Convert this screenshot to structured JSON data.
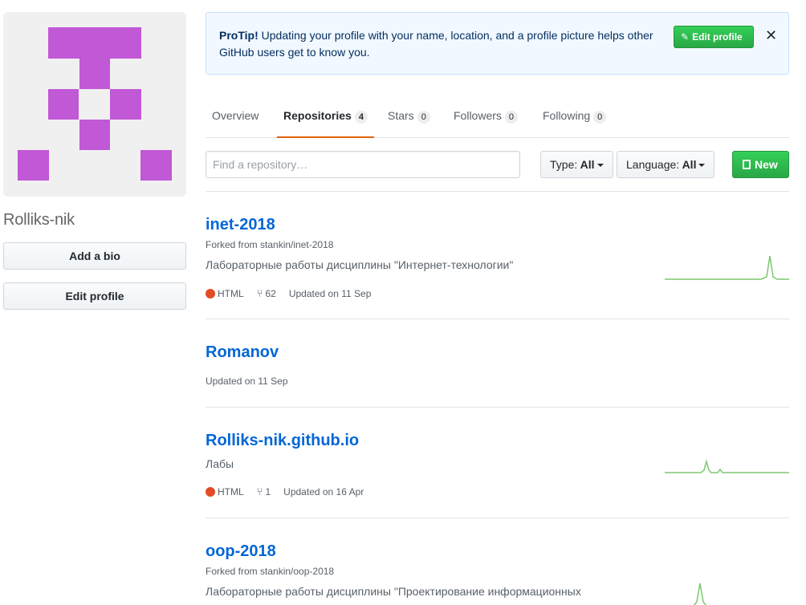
{
  "profile": {
    "username": "Rolliks-nik",
    "add_bio_label": "Add a bio",
    "edit_profile_label": "Edit profile",
    "avatar_color": "#c158d6"
  },
  "protip": {
    "bold": "ProTip!",
    "text": " Updating your profile with your name, location, and a profile picture helps other GitHub users get to know you.",
    "button": "Edit profile",
    "close": "✕"
  },
  "tabs": [
    {
      "label": "Overview",
      "count": ""
    },
    {
      "label": "Repositories",
      "count": "4"
    },
    {
      "label": "Stars",
      "count": "0"
    },
    {
      "label": "Followers",
      "count": "0"
    },
    {
      "label": "Following",
      "count": "0"
    }
  ],
  "filters": {
    "search_placeholder": "Find a repository…",
    "type_label": "Type:",
    "type_value": "All",
    "language_label": "Language:",
    "language_value": "All",
    "new_label": "New"
  },
  "repos": [
    {
      "name": "inet-2018",
      "fork": "Forked from stankin/inet-2018",
      "desc": "Лабораторные работы дисциплины \"Интернет-технологии\"",
      "lang": "HTML",
      "forks": "62",
      "updated": "Updated on 11 Sep"
    },
    {
      "name": "Romanov",
      "fork": "",
      "desc": "",
      "lang": "",
      "forks": "",
      "updated": "Updated on 11 Sep"
    },
    {
      "name": "Rolliks-nik.github.io",
      "fork": "",
      "desc": "Лабы",
      "lang": "HTML",
      "forks": "1",
      "updated": "Updated on 16 Apr"
    },
    {
      "name": "oop-2018",
      "fork": "Forked from stankin/oop-2018",
      "desc": "Лабораторные работы дисциплины \"Проектирование информационных",
      "lang": "",
      "forks": "",
      "updated": ""
    }
  ],
  "colors": {
    "link": "#0366d6",
    "green": "#28a745",
    "html_lang": "#e34c26",
    "tab_underline": "#e36209",
    "sparkline": "#7bc96f"
  }
}
